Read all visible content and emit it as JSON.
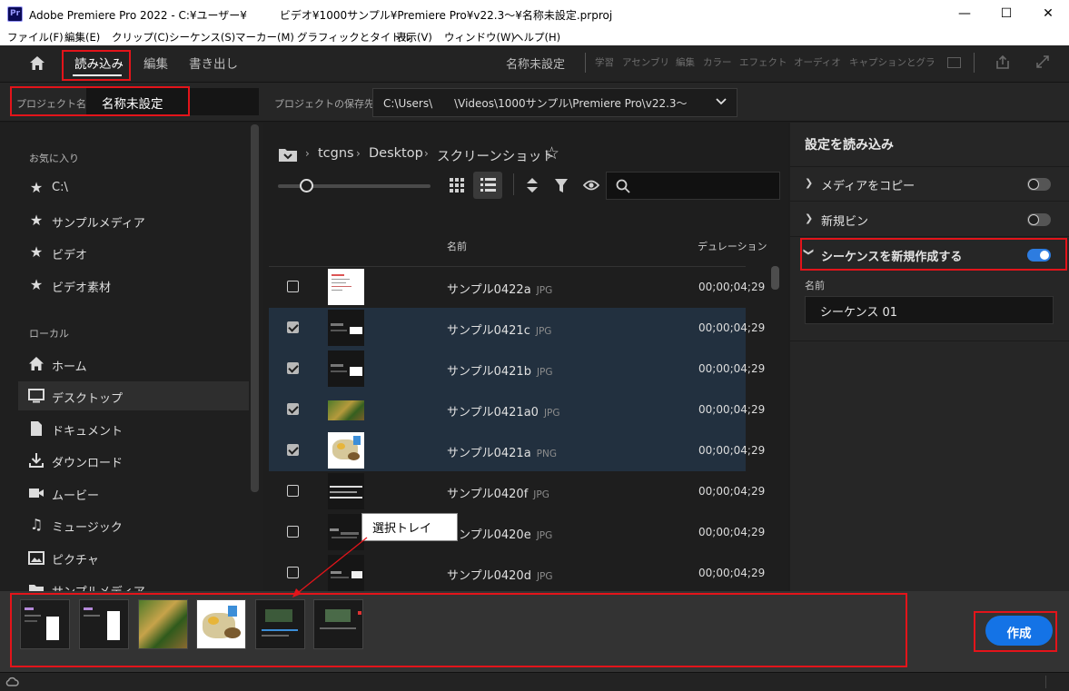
{
  "window": {
    "app_badge": "Pr",
    "title": "Adobe Premiere Pro 2022 - C:¥ユーザー¥　　　ビデオ¥1000サンプル¥Premiere Pro¥v22.3～¥名称未設定.prproj",
    "minimize": "—",
    "maximize": "☐",
    "close": "✕"
  },
  "menu": [
    "ファイル(F)",
    "編集(E)",
    "クリップ(C)",
    "シーケンス(S)",
    "マーカー(M)",
    "グラフィックとタイトル",
    "表示(V)",
    "ウィンドウ(W)",
    "ヘルプ(H)"
  ],
  "header": {
    "home_icon": "home-icon",
    "tabs": [
      "読み込み",
      "編集",
      "書き出し"
    ],
    "project_title": "名称未設定",
    "workspaces": [
      "学習",
      "アセンブリ",
      "編集",
      "カラー",
      "エフェクト",
      "オーディオ",
      "キャプションとグラ"
    ]
  },
  "project": {
    "name_label": "プロジェクト名",
    "name_value": "名称未設定",
    "location_label": "プロジェクトの保存先",
    "location_value": "C:\\Users\\　　\\Videos\\1000サンプル\\Premiere Pro\\v22.3～"
  },
  "sidebar": {
    "favorites_title": "お気に入り",
    "favorites": [
      {
        "label": "C:\\",
        "icon": "star-icon"
      },
      {
        "label": "サンプルメディア",
        "icon": "star-icon"
      },
      {
        "label": "ビデオ",
        "icon": "star-icon"
      },
      {
        "label": "ビデオ素材",
        "icon": "star-icon"
      }
    ],
    "local_title": "ローカル",
    "local": [
      {
        "label": "ホーム",
        "icon": "home-icon"
      },
      {
        "label": "デスクトップ",
        "icon": "desktop-icon"
      },
      {
        "label": "ドキュメント",
        "icon": "document-icon"
      },
      {
        "label": "ダウンロード",
        "icon": "download-icon"
      },
      {
        "label": "ムービー",
        "icon": "video-camera-icon"
      },
      {
        "label": "ミュージック",
        "icon": "music-note-icon"
      },
      {
        "label": "ピクチャ",
        "icon": "picture-icon"
      },
      {
        "label": "サンプルメディア",
        "icon": "folder-icon"
      }
    ]
  },
  "browser": {
    "breadcrumb": [
      "tcgns",
      "Desktop",
      "スクリーンショット"
    ],
    "col_name": "名前",
    "col_duration": "デュレーション",
    "files": [
      {
        "name": "サンプル0422a",
        "ext": "JPG",
        "duration": "00;00;04;29",
        "checked": false
      },
      {
        "name": "サンプル0421c",
        "ext": "JPG",
        "duration": "00;00;04;29",
        "checked": true
      },
      {
        "name": "サンプル0421b",
        "ext": "JPG",
        "duration": "00;00;04;29",
        "checked": true
      },
      {
        "name": "サンプル0421a0",
        "ext": "JPG",
        "duration": "00;00;04;29",
        "checked": true
      },
      {
        "name": "サンプル0421a",
        "ext": "PNG",
        "duration": "00;00;04;29",
        "checked": true
      },
      {
        "name": "サンプル0420f",
        "ext": "JPG",
        "duration": "00;00;04;29",
        "checked": false
      },
      {
        "name": "サンプル0420e",
        "ext": "JPG",
        "duration": "00;00;04;29",
        "checked": false
      },
      {
        "name": "サンプル0420d",
        "ext": "JPG",
        "duration": "00;00;04;29",
        "checked": false
      }
    ]
  },
  "settings": {
    "title": "設定を読み込み",
    "copy_media": "メディアをコピー",
    "copy_media_on": false,
    "new_bin": "新規ビン",
    "new_bin_on": false,
    "new_sequence": "シーケンスを新規作成する",
    "new_sequence_on": true,
    "seq_name_label": "名前",
    "seq_name_value": "シーケンス 01"
  },
  "tray": {
    "callout": "選択トレイ",
    "count": 6
  },
  "create_button": "作成",
  "colors": {
    "accent_blue": "#2d7ce0",
    "annotation_red": "#e3141a"
  }
}
